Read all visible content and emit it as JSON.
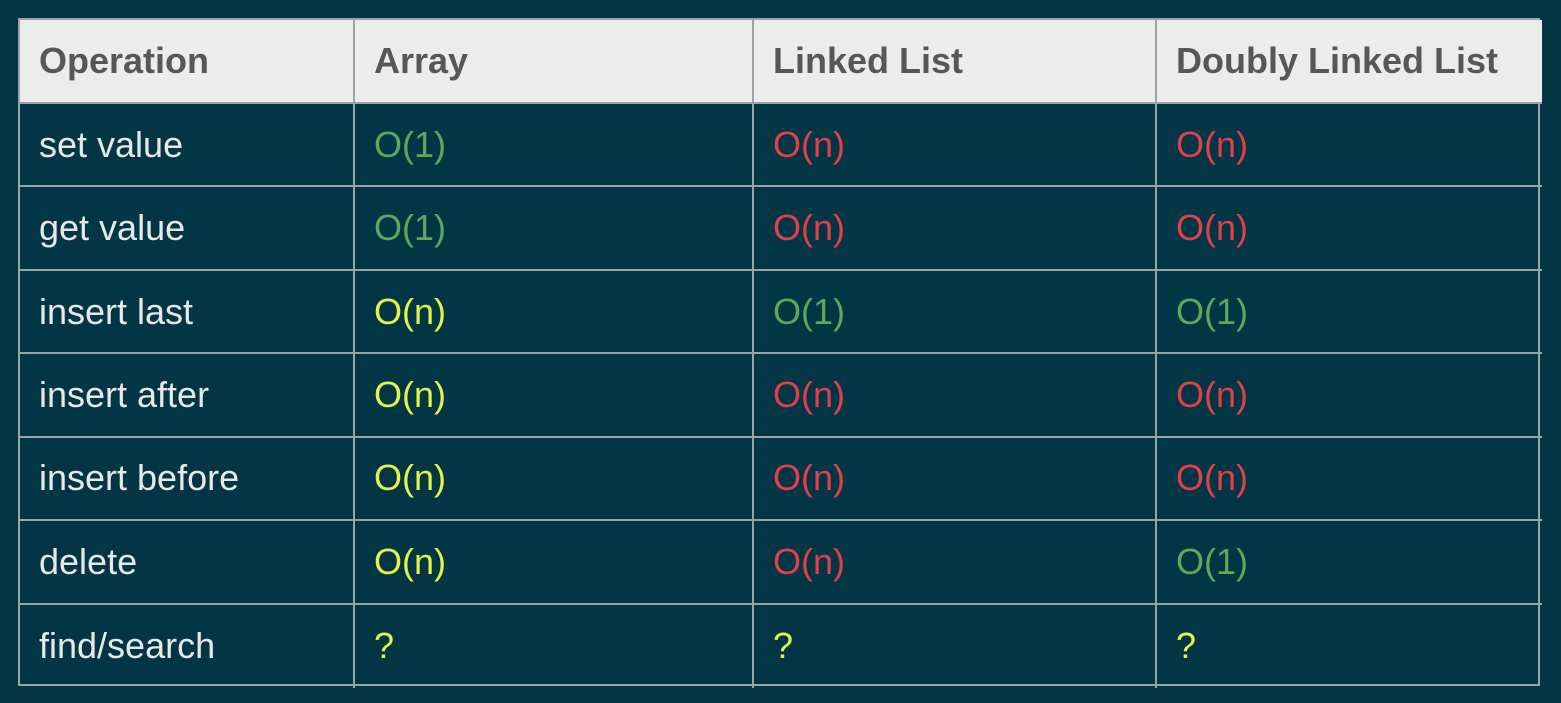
{
  "colors": {
    "background": "#033645",
    "header_bg": "#ececec",
    "header_text": "#575757",
    "border": "#9aa3a6",
    "op_text": "#e8e8e8",
    "green": "#5ea85a",
    "red": "#e0404a",
    "yellow": "#e4f24a"
  },
  "table": {
    "headers": [
      "Operation",
      "Array",
      "Linked List",
      "Doubly Linked List"
    ],
    "rows": [
      {
        "op": "set value",
        "cells": [
          {
            "text": "O(1)",
            "color": "green"
          },
          {
            "text": "O(n)",
            "color": "red"
          },
          {
            "text": "O(n)",
            "color": "red"
          }
        ]
      },
      {
        "op": "get value",
        "cells": [
          {
            "text": "O(1)",
            "color": "green"
          },
          {
            "text": "O(n)",
            "color": "red"
          },
          {
            "text": "O(n)",
            "color": "red"
          }
        ]
      },
      {
        "op": "insert last",
        "cells": [
          {
            "text": "O(n)",
            "color": "yellow"
          },
          {
            "text": "O(1)",
            "color": "green"
          },
          {
            "text": "O(1)",
            "color": "green"
          }
        ]
      },
      {
        "op": "insert after",
        "cells": [
          {
            "text": "O(n)",
            "color": "yellow"
          },
          {
            "text": "O(n)",
            "color": "red"
          },
          {
            "text": "O(n)",
            "color": "red"
          }
        ]
      },
      {
        "op": "insert before",
        "cells": [
          {
            "text": "O(n)",
            "color": "yellow"
          },
          {
            "text": "O(n)",
            "color": "red"
          },
          {
            "text": "O(n)",
            "color": "red"
          }
        ]
      },
      {
        "op": "delete",
        "cells": [
          {
            "text": "O(n)",
            "color": "yellow"
          },
          {
            "text": "O(n)",
            "color": "red"
          },
          {
            "text": "O(1)",
            "color": "green"
          }
        ]
      },
      {
        "op": "find/search",
        "cells": [
          {
            "text": "?",
            "color": "yellow"
          },
          {
            "text": "?",
            "color": "yellow"
          },
          {
            "text": "?",
            "color": "yellow"
          }
        ]
      }
    ]
  }
}
